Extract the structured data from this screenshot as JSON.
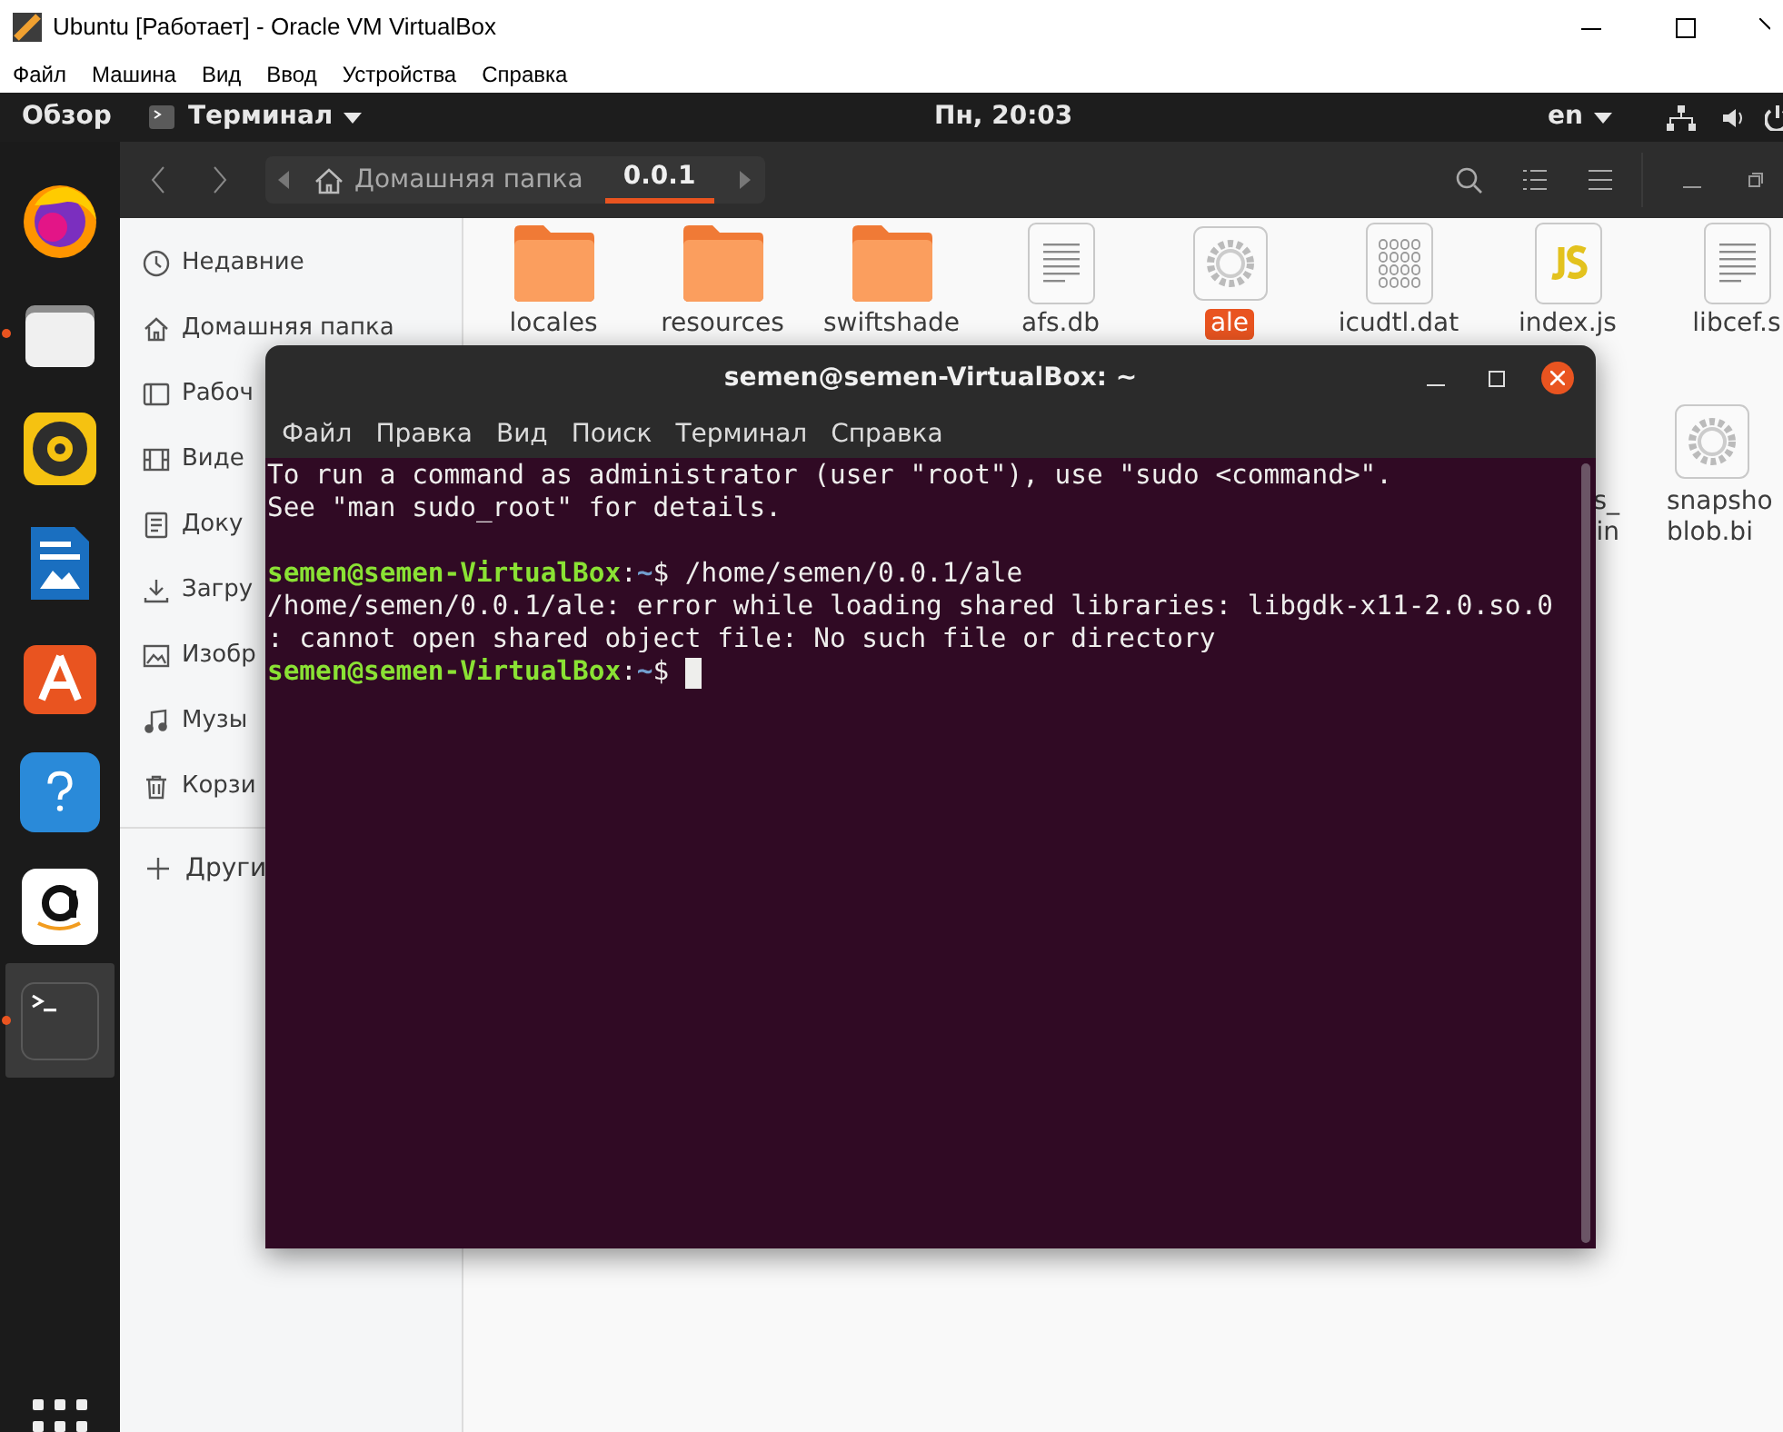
{
  "host_window": {
    "title": "Ubuntu [Работает] - Oracle VM VirtualBox",
    "menu": [
      "Файл",
      "Машина",
      "Вид",
      "Ввод",
      "Устройства",
      "Справка"
    ]
  },
  "top_bar": {
    "activities": "Обзор",
    "app_menu": "Терминал",
    "clock": "Пн, 20:03",
    "keyboard_layout": "en"
  },
  "dock": [
    {
      "kind": "firefox",
      "running": false,
      "selected": false
    },
    {
      "kind": "files",
      "running": true,
      "selected": false
    },
    {
      "kind": "music",
      "running": false,
      "selected": false
    },
    {
      "kind": "writer",
      "running": false,
      "selected": false
    },
    {
      "kind": "software",
      "running": false,
      "selected": false
    },
    {
      "kind": "help",
      "running": false,
      "selected": false
    },
    {
      "kind": "amazon",
      "running": false,
      "selected": false
    },
    {
      "kind": "terminal",
      "running": true,
      "selected": true
    }
  ],
  "file_manager": {
    "path": [
      {
        "label": "Домашняя папка",
        "selected": false
      },
      {
        "label": "0.0.1",
        "selected": true
      }
    ],
    "sidebar": [
      {
        "kind": "recent",
        "label": "Недавние"
      },
      {
        "kind": "home",
        "label": "Домашняя папка"
      },
      {
        "kind": "desktop",
        "label": "Рабоч"
      },
      {
        "kind": "video",
        "label": "Виде"
      },
      {
        "kind": "documents",
        "label": "Доку"
      },
      {
        "kind": "downloads",
        "label": "Загру"
      },
      {
        "kind": "pictures",
        "label": "Изобр"
      },
      {
        "kind": "music",
        "label": "Музы"
      },
      {
        "kind": "trash",
        "label": "Корзи"
      }
    ],
    "other_locations": "Други",
    "file_rows": [
      [
        {
          "kind": "folder",
          "lines": [
            "locales"
          ],
          "selected": false
        },
        {
          "kind": "folder",
          "lines": [
            "resources"
          ],
          "selected": false
        },
        {
          "kind": "folder",
          "lines": [
            "swiftshade"
          ],
          "selected": false
        },
        {
          "kind": "text",
          "lines": [
            "afs.db"
          ],
          "selected": false
        },
        {
          "kind": "exec",
          "lines": [
            "ale"
          ],
          "selected": true
        },
        {
          "kind": "binary",
          "lines": [
            "icudtl.dat"
          ],
          "selected": false
        },
        {
          "kind": "js",
          "lines": [
            "index.js"
          ],
          "selected": false
        },
        {
          "kind": "text",
          "lines": [
            "libcef.s"
          ],
          "selected": false
        }
      ],
      [
        {
          "kind": "partial",
          "lines": [
            "s_",
            "in"
          ],
          "selected": false
        },
        {
          "kind": "exec",
          "lines": [
            "snapsho",
            "blob.bi"
          ],
          "selected": false
        }
      ]
    ]
  },
  "terminal": {
    "title": "semen@semen-VirtualBox: ~",
    "menu": [
      "Файл",
      "Правка",
      "Вид",
      "Поиск",
      "Терминал",
      "Справка"
    ],
    "lines": [
      {
        "kind": "text",
        "text": "To run a command as administrator (user \"root\"), use \"sudo <command>\"."
      },
      {
        "kind": "text",
        "text": "See \"man sudo_root\" for details."
      },
      {
        "kind": "blank"
      },
      {
        "kind": "prompt",
        "user": "semen@semen-VirtualBox",
        "separator": ":",
        "path": "~",
        "symbol": "$",
        "command": "/home/semen/0.0.1/ale",
        "cursor": false
      },
      {
        "kind": "text",
        "text": "/home/semen/0.0.1/ale: error while loading shared libraries: libgdk-x11-2.0.so.0"
      },
      {
        "kind": "text",
        "text": ": cannot open shared object file: No such file or directory"
      },
      {
        "kind": "prompt",
        "user": "semen@semen-VirtualBox",
        "separator": ":",
        "path": "~",
        "symbol": "$",
        "cursor": true
      }
    ]
  }
}
